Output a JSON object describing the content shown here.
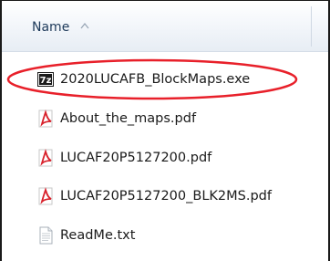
{
  "header": {
    "column_label": "Name",
    "sort_icon": "sort-ascending-icon"
  },
  "files": [
    {
      "name": "2020LUCAFB_BlockMaps.exe",
      "icon": "7zip-exe-icon",
      "highlighted": true
    },
    {
      "name": "About_the_maps.pdf",
      "icon": "pdf-icon"
    },
    {
      "name": "LUCAF20P5127200.pdf",
      "icon": "pdf-icon"
    },
    {
      "name": "LUCAF20P5127200_BLK2MS.pdf",
      "icon": "pdf-icon"
    },
    {
      "name": "ReadMe.txt",
      "icon": "text-file-icon"
    }
  ],
  "colors": {
    "highlight": "#e8202a",
    "pdf_red": "#d8212b",
    "header_text": "#1e3a5a"
  }
}
